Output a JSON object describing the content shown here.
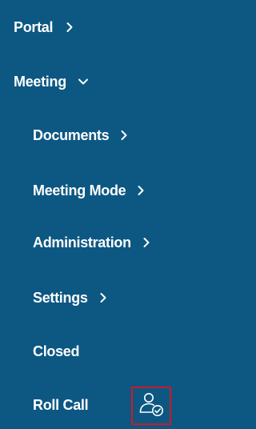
{
  "nav": {
    "portal": {
      "label": "Portal",
      "icon": "chevron-right-icon"
    },
    "meeting": {
      "label": "Meeting",
      "icon": "chevron-down-icon"
    },
    "meeting_items": [
      {
        "label": "Documents",
        "icon": "chevron-right-icon"
      },
      {
        "label": "Meeting Mode",
        "icon": "chevron-right-icon"
      },
      {
        "label": "Administration",
        "icon": "chevron-right-icon"
      },
      {
        "label": "Settings",
        "icon": "chevron-right-icon"
      },
      {
        "label": "Closed"
      },
      {
        "label": "Roll Call",
        "icon": "user-check-icon"
      }
    ]
  },
  "colors": {
    "background": "#0d5783",
    "text": "#ffffff",
    "highlight_border": "#d01824"
  }
}
